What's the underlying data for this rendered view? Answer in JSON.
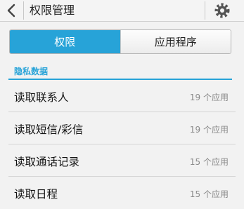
{
  "header": {
    "title": "权限管理",
    "back_icon": "chevron-left-icon",
    "settings_icon": "gear-icon"
  },
  "tabs": [
    {
      "label": "权限",
      "active": true
    },
    {
      "label": "应用程序",
      "active": false
    }
  ],
  "section": {
    "title": "隐私数据"
  },
  "permissions": [
    {
      "label": "读取联系人",
      "count": "19 个应用"
    },
    {
      "label": "读取短信/彩信",
      "count": "19 个应用"
    },
    {
      "label": "读取通话记录",
      "count": "15 个应用"
    },
    {
      "label": "读取日程",
      "count": "15 个应用"
    }
  ],
  "colors": {
    "accent": "#27a3d8"
  }
}
